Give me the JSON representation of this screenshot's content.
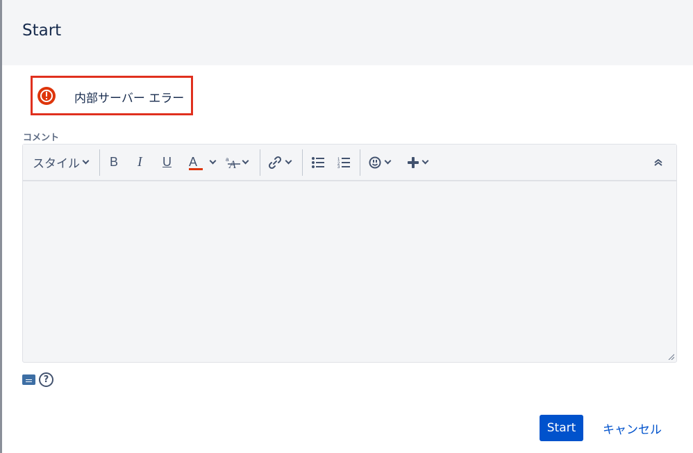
{
  "dialog": {
    "title": "Start"
  },
  "error": {
    "icon": "error-icon",
    "message": "内部サーバー エラー",
    "border_color": "#e0301e",
    "icon_color": "#de350b"
  },
  "comment": {
    "label": "コメント"
  },
  "toolbar": {
    "style_label": "スタイル",
    "bold_label": "B",
    "italic_label": "I",
    "underline_label": "U",
    "text_color_label": "A",
    "text_color_accent": "#de350b",
    "icons": [
      "chevron-down-icon",
      "format-icon",
      "link-icon",
      "bullet-list-icon",
      "numbered-list-icon",
      "emoji-icon",
      "plus-icon",
      "collapse-icon"
    ]
  },
  "footer": {
    "primary_button": "Start",
    "cancel_button": "キャンセル",
    "primary_color": "#0052cc"
  }
}
